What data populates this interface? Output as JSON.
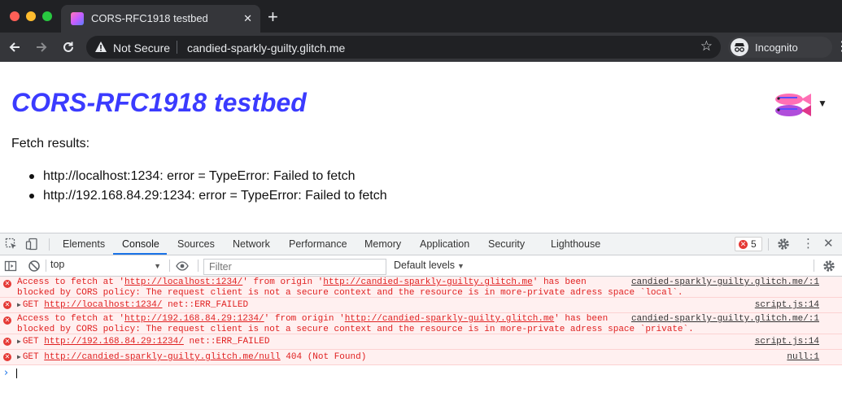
{
  "browser": {
    "tab_title": "CORS-RFC1918 testbed",
    "tab_close": "✕",
    "new_tab": "+",
    "security_label": "Not Secure",
    "url": "candied-sparkly-guilty.glitch.me",
    "profile_label": "Incognito"
  },
  "page": {
    "title": "CORS-RFC1918 testbed",
    "heading": "Fetch results:",
    "results": [
      "http://localhost:1234: error = TypeError: Failed to fetch",
      "http://192.168.84.29:1234: error = TypeError: Failed to fetch"
    ]
  },
  "devtools": {
    "tabs": [
      "Elements",
      "Console",
      "Sources",
      "Network",
      "Performance",
      "Memory",
      "Application",
      "Security",
      "Lighthouse"
    ],
    "active_tab": "Console",
    "error_count": "5",
    "context": "top",
    "filter_placeholder": "Filter",
    "levels": "Default levels",
    "messages": [
      {
        "line1_pre": "Access to fetch at '",
        "line1_link1": "http://localhost:1234/",
        "line1_mid": "' from origin '",
        "line1_link2": "http://candied-sparkly-guilty.glitch.me",
        "line1_post": "' has been",
        "line2": "blocked by CORS policy: The request client is not a secure context and the resource is in more-private adress space `local`.",
        "source": "candied-sparkly-guilty.glitch.me/:1"
      },
      {
        "prefix": "GET ",
        "link": "http://localhost:1234/",
        "suffix": " net::ERR_FAILED",
        "source": "script.js:14"
      },
      {
        "line1_pre": "Access to fetch at '",
        "line1_link1": "http://192.168.84.29:1234/",
        "line1_mid": "' from origin '",
        "line1_link2": "http://candied-sparkly-guilty.glitch.me",
        "line1_post": "' has been",
        "line2": "blocked by CORS policy: The request client is not a secure context and the resource is in more-private adress space `private`.",
        "source": "candied-sparkly-guilty.glitch.me/:1"
      },
      {
        "prefix": "GET ",
        "link": "http://192.168.84.29:1234/",
        "suffix": " net::ERR_FAILED",
        "source": "script.js:14"
      },
      {
        "prefix": "GET ",
        "link": "http://candied-sparkly-guilty.glitch.me/null",
        "suffix": " 404 (Not Found)",
        "source": "null:1"
      }
    ]
  },
  "colors": {
    "title": "#3b3bff",
    "error_text": "#e02020",
    "error_bg": "#fff0f0",
    "chrome_dark": "#202124",
    "active_tab_underline": "#1a73e8"
  },
  "icons": {
    "tab_favicon": "glitch-favicon-icon",
    "back": "arrow-left-icon",
    "forward": "arrow-right-icon",
    "reload": "reload-icon",
    "warning": "warning-triangle-icon",
    "bookmark": "star-icon",
    "incognito": "incognito-icon",
    "logo": "glitch-fish-logo-icon",
    "error": "error-circle-icon"
  }
}
